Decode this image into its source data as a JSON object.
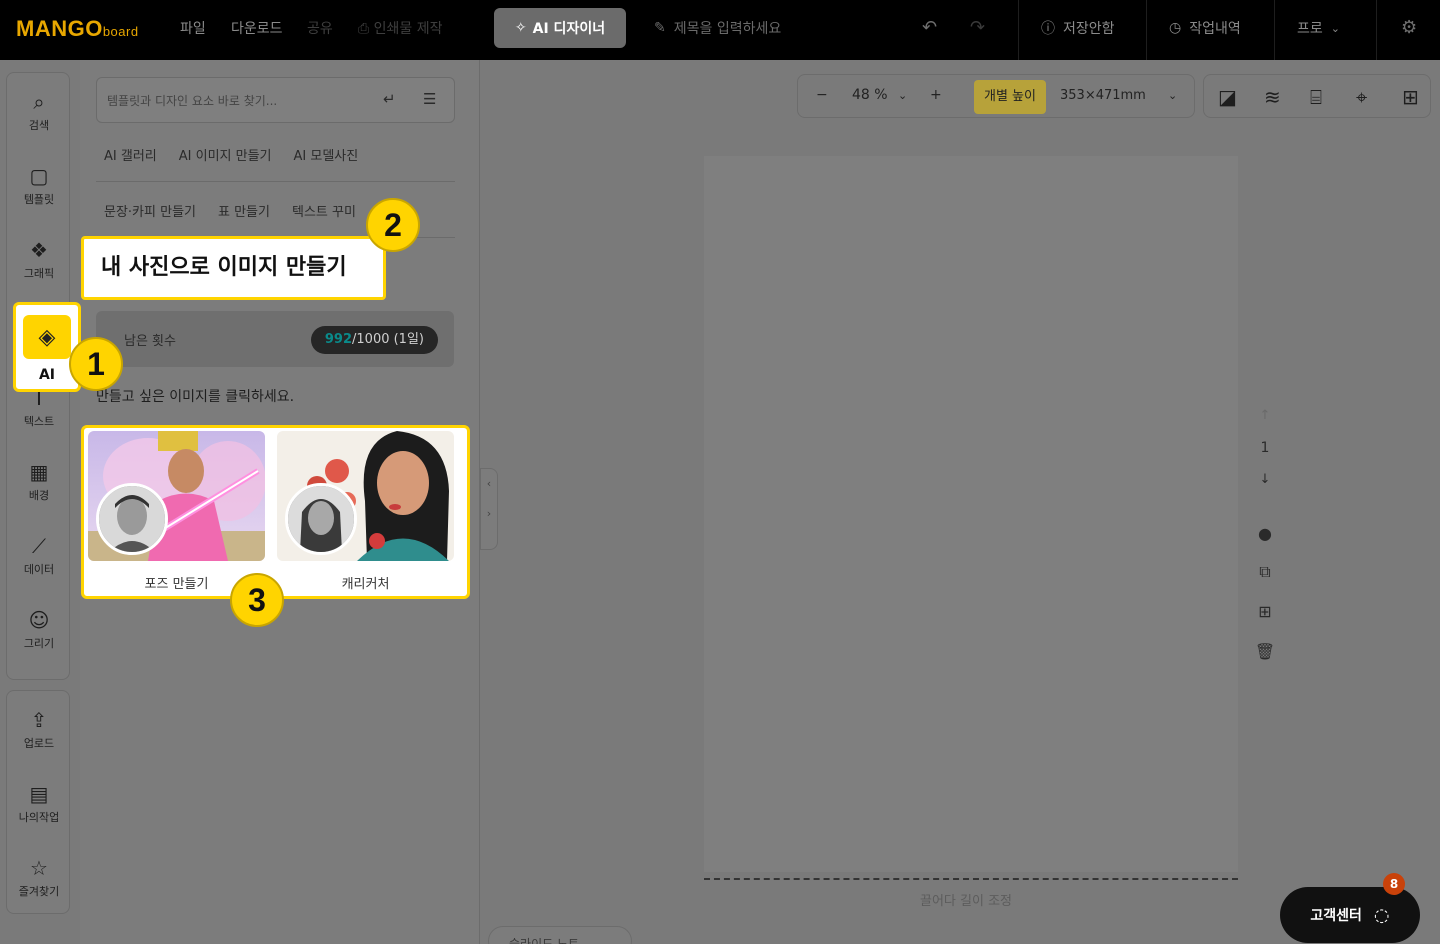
{
  "topbar": {
    "logo_main": "MANGO",
    "logo_sub": "board",
    "menu_file": "파일",
    "menu_download": "다운로드",
    "menu_share": "공유",
    "menu_print": "인쇄물 제작",
    "ai_designer": "AI 디자이너",
    "title_placeholder": "제목을 입력하세요",
    "save_status": "저장안함",
    "history": "작업내역",
    "plan": "프로"
  },
  "rail": {
    "items": [
      {
        "label": "검색",
        "icon": "search-icon"
      },
      {
        "label": "템플릿",
        "icon": "template-icon"
      },
      {
        "label": "그래픽",
        "icon": "graphic-icon"
      },
      {
        "label": "AI",
        "icon": "ai-chip-icon"
      },
      {
        "label": "텍스트",
        "icon": "text-icon"
      },
      {
        "label": "배경",
        "icon": "background-icon"
      },
      {
        "label": "데이터",
        "icon": "chart-icon"
      },
      {
        "label": "그리기",
        "icon": "draw-icon"
      }
    ],
    "bottom_items": [
      {
        "label": "업로드",
        "icon": "upload-icon"
      },
      {
        "label": "나의작업",
        "icon": "my-work-icon"
      },
      {
        "label": "즐겨찾기",
        "icon": "favorite-icon"
      }
    ]
  },
  "panel": {
    "search_placeholder": "템플릿과 디자인 요소 바로 찾기...",
    "tabs_row1": [
      "AI 갤러리",
      "AI 이미지 만들기",
      "AI 모델사진"
    ],
    "tabs_row2": [
      "문장·카피 만들기",
      "표 만들기",
      "텍스트 꾸미"
    ],
    "remaining_label": "남은 횟수",
    "remaining_used": "992",
    "remaining_rest": "/1000 (1일)",
    "instruction": "만들고 싶은 이미지를 클릭하세요.",
    "cards": [
      {
        "label": "포즈 만들기"
      },
      {
        "label": "캐리커처"
      }
    ]
  },
  "callouts": {
    "title": "내 사진으로 이미지 만들기",
    "badge1": "1",
    "badge2": "2",
    "badge3": "3",
    "ai_label": "AI"
  },
  "canvas": {
    "zoom": "48 %",
    "height_btn": "개별 높이",
    "size": "353×471mm",
    "page_num": "1",
    "drag_hint": "끌어다 길이 조정",
    "bottom_tab": "슬라이드 노트"
  },
  "help": {
    "label": "고객센터",
    "badge": "8"
  },
  "colors": {
    "accent": "#ffd400",
    "brand": "#e8a700",
    "topbar_bg": "#000000"
  }
}
